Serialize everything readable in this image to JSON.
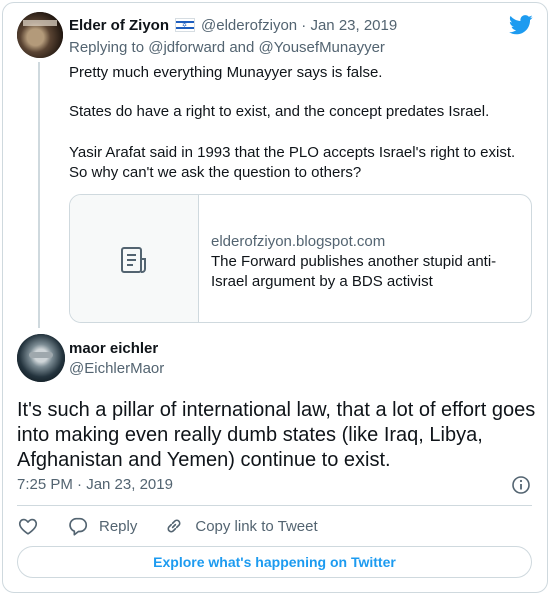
{
  "parent_tweet": {
    "author_name": "Elder of Ziyon",
    "handle": "@elderofziyon",
    "separator": "·",
    "date": "Jan 23, 2019",
    "replying_prefix": "Replying to",
    "replying_to_1": "@jdforward",
    "replying_and": "and",
    "replying_to_2": "@YousefMunayyer",
    "lines": [
      "Pretty much everything Munayyer says is false.",
      "States do have a right to exist, and the concept predates Israel.",
      "Yasir Arafat said in 1993 that the PLO accepts Israel's  right to  exist.",
      "So why can't we ask the question to others?"
    ],
    "link_card": {
      "domain": "elderofziyon.blogspot.com",
      "title": "The Forward publishes another stupid anti-Israel argument by a BDS activist",
      "thumbnail_icon": "document-icon"
    }
  },
  "main_tweet": {
    "author_name": "maor eichler",
    "handle": "@EichlerMaor",
    "text": "It's such a pillar of international law, that a lot of effort goes into making even really dumb states (like Iraq, Libya, Afghanistan and Yemen) continue to exist.",
    "timestamp": "7:25 PM · Jan 23, 2019"
  },
  "actions": {
    "like_icon": "heart-icon",
    "reply_label": "Reply",
    "copy_label": "Copy link to Tweet"
  },
  "explore_label": "Explore what's happening on Twitter",
  "colors": {
    "accent": "#1d9bf0",
    "text": "#0f1419",
    "secondary": "#536471",
    "border": "#cfd9de"
  }
}
